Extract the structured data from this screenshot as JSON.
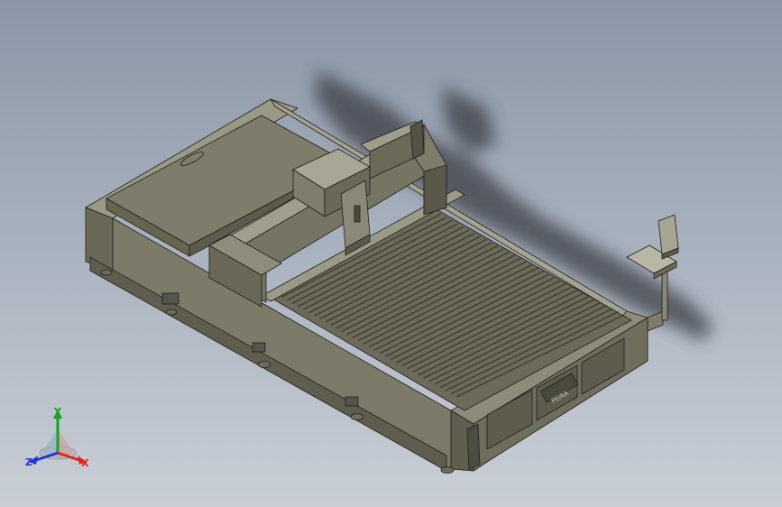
{
  "model": {
    "nameplate": "PEIRA",
    "colors": {
      "body_light": "#8c8b79",
      "body_mid": "#737262",
      "body_dark": "#4a4a3e",
      "edge": "#1f1f1a",
      "shadow": "#3a3d44",
      "bed_slat": "#5b5b4d"
    }
  },
  "triad": {
    "x_label": "X",
    "y_label": "Y",
    "z_label": "Z",
    "colors": {
      "x": "#e0261b",
      "y": "#1aa01f",
      "z": "#2136d6"
    }
  }
}
